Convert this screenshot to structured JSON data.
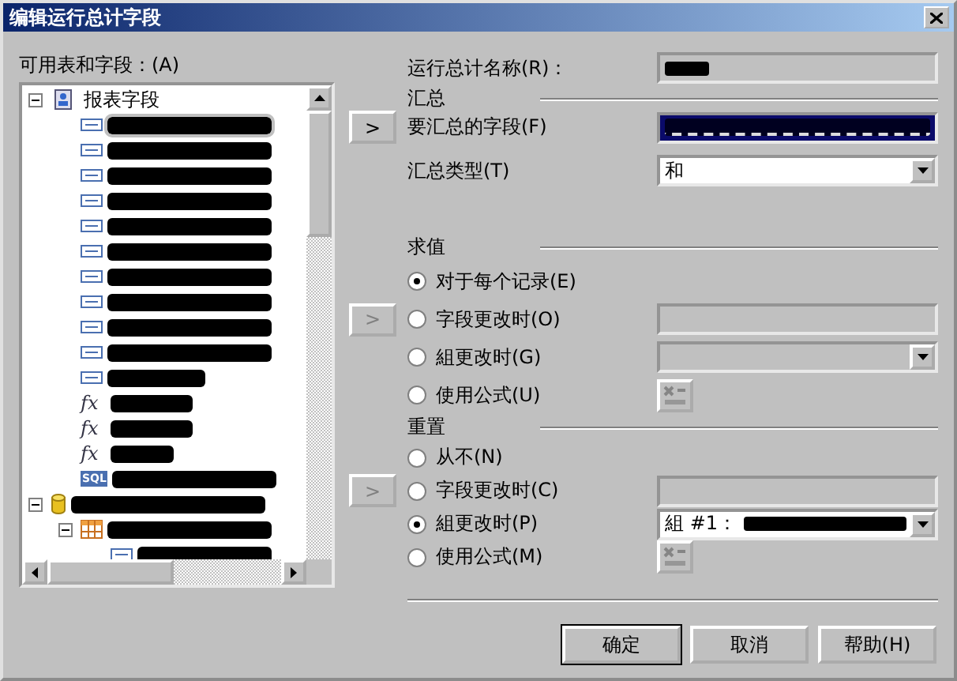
{
  "window": {
    "title": "编辑运行总计字段"
  },
  "tree": {
    "label": "可用表和字段：(A)",
    "items": [
      {
        "kind": "group",
        "label": "报表字段",
        "expanded": true,
        "selected": false,
        "children": [
          {
            "kind": "field",
            "selected": true
          },
          {
            "kind": "field",
            "selected": false
          },
          {
            "kind": "field",
            "selected": false
          },
          {
            "kind": "field",
            "selected": false
          },
          {
            "kind": "field",
            "selected": false
          },
          {
            "kind": "field",
            "selected": false
          },
          {
            "kind": "field",
            "selected": false
          },
          {
            "kind": "field",
            "selected": false
          },
          {
            "kind": "field",
            "selected": false
          },
          {
            "kind": "field",
            "selected": false
          },
          {
            "kind": "field",
            "selected": false
          },
          {
            "kind": "formula",
            "icon_text": "fx",
            "selected": false
          },
          {
            "kind": "formula",
            "icon_text": "fx",
            "selected": false
          },
          {
            "kind": "formula",
            "icon_text": "fx",
            "selected": false
          },
          {
            "kind": "sql",
            "icon_text": "SQL",
            "selected": false
          }
        ]
      },
      {
        "kind": "database",
        "expanded": true,
        "selected": false,
        "children": [
          {
            "kind": "table",
            "expanded": true,
            "selected": false,
            "children": [
              {
                "kind": "field",
                "selected": false
              }
            ]
          }
        ]
      }
    ]
  },
  "name_row": {
    "label": "运行总计名称(R)："
  },
  "summary": {
    "heading": "汇总",
    "arrow_button": {
      "label": ">",
      "disabled": false
    },
    "field_label": "要汇总的字段(F)",
    "field_focused": true,
    "type_label": "汇总类型(T)",
    "type_value": "和"
  },
  "evaluate": {
    "heading": "求值",
    "options": [
      {
        "label": "对于每个记录(E)",
        "selected": true
      },
      {
        "label": "字段更改时(O)",
        "selected": false,
        "arrow_button": {
          "label": ">",
          "disabled": true
        },
        "control": {
          "kind": "field",
          "disabled": true
        }
      },
      {
        "label": "組更改时(G)",
        "selected": false,
        "control": {
          "kind": "dropdown",
          "disabled": true
        }
      },
      {
        "label": "使用公式(U)",
        "selected": false,
        "control": {
          "kind": "formula_button",
          "disabled": true
        }
      }
    ]
  },
  "reset": {
    "heading": "重置",
    "options": [
      {
        "label": "从不(N)",
        "selected": false
      },
      {
        "label": "字段更改时(C)",
        "selected": false,
        "arrow_button": {
          "label": ">",
          "disabled": true
        },
        "control": {
          "kind": "field",
          "disabled": true
        }
      },
      {
        "label": "組更改时(P)",
        "selected": true,
        "control": {
          "kind": "dropdown",
          "disabled": false,
          "value": "組 #1："
        }
      },
      {
        "label": "使用公式(M)",
        "selected": false,
        "control": {
          "kind": "formula_button",
          "disabled": true
        }
      }
    ]
  },
  "buttons": [
    {
      "label": "确定",
      "default": true
    },
    {
      "label": "取消",
      "default": false
    },
    {
      "label": "帮助(H)",
      "default": false
    }
  ]
}
